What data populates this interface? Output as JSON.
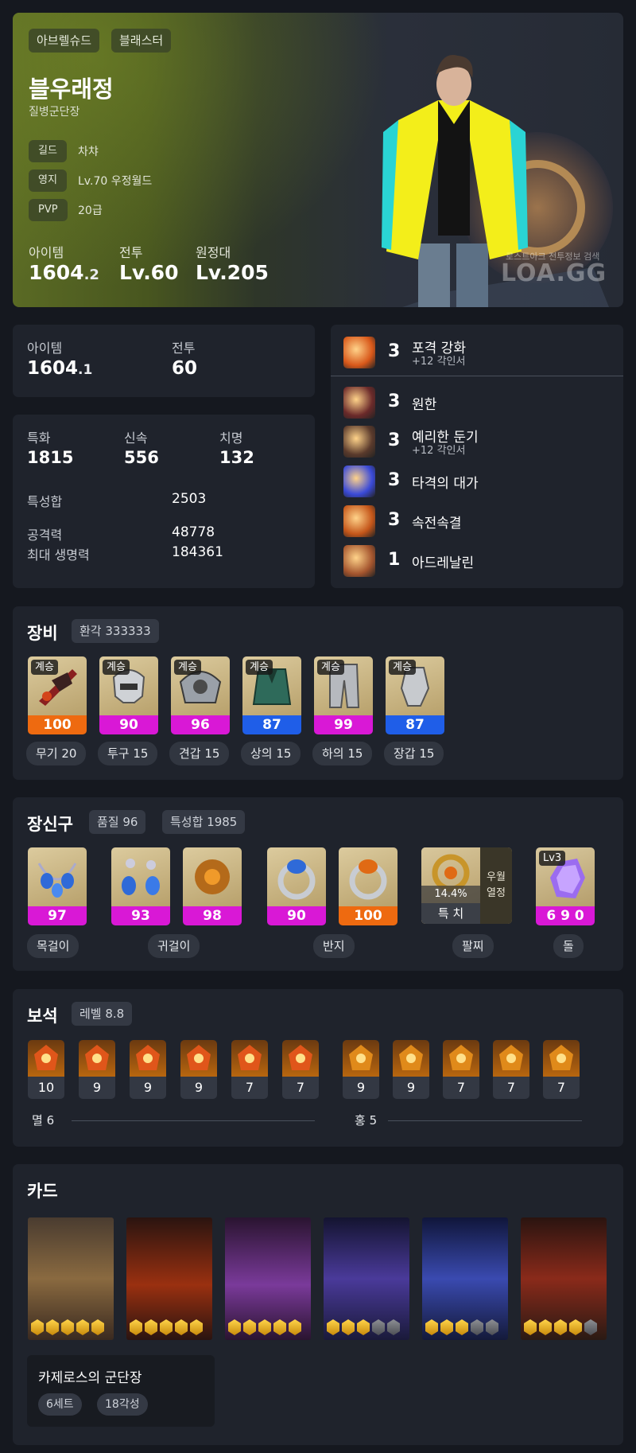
{
  "hero": {
    "server": "아브렐슈드",
    "class": "블래스터",
    "name": "블우래정",
    "title": "질병군단장",
    "info": [
      {
        "key": "길드",
        "value": "차챠"
      },
      {
        "key": "영지",
        "value": "Lv.70 우정월드"
      },
      {
        "key": "PVP",
        "value": "20급"
      }
    ],
    "stats": [
      {
        "label": "아이템",
        "main": "1604",
        "sub": ".2"
      },
      {
        "label": "전투",
        "main": "Lv.60",
        "sub": ""
      },
      {
        "label": "원정대",
        "main": "Lv.205",
        "sub": ""
      }
    ],
    "watermark_top": "로스트아크 전투정보 검색",
    "watermark": "LOA.GG"
  },
  "level_box": {
    "item_label": "아이템",
    "item_main": "1604",
    "item_sub": ".1",
    "combat_label": "전투",
    "combat_value": "60"
  },
  "stats_box": {
    "top": [
      {
        "label": "특화",
        "value": "1815"
      },
      {
        "label": "신속",
        "value": "556"
      },
      {
        "label": "치명",
        "value": "132"
      }
    ],
    "sum_label": "특성합",
    "sum_value": "2503",
    "atk_label": "공격력",
    "atk_value": "48778",
    "hp_label": "최대 생명력",
    "hp_value": "184361"
  },
  "engravings": [
    {
      "level": "3",
      "name": "포격 강화",
      "sub": "+12 각인서",
      "color": "#d8581a"
    },
    {
      "level": "3",
      "name": "원한",
      "sub": "",
      "color": "#6b2a2a"
    },
    {
      "level": "3",
      "name": "예리한 둔기",
      "sub": "+12 각인서",
      "color": "#5a3a2c"
    },
    {
      "level": "3",
      "name": "타격의 대가",
      "sub": "",
      "color": "#3a4ad8"
    },
    {
      "level": "3",
      "name": "속전속결",
      "sub": "",
      "color": "#c4561a"
    },
    {
      "level": "1",
      "name": "아드레날린",
      "sub": "",
      "color": "#a4552e"
    }
  ],
  "equipment": {
    "title": "장비",
    "badge": "환각 333333",
    "items": [
      {
        "tag": "계승",
        "quality": "100",
        "label": "무기 20",
        "color": "orange",
        "icon": "weapon-icon"
      },
      {
        "tag": "계승",
        "quality": "90",
        "label": "투구 15",
        "color": "magenta",
        "icon": "helmet-icon"
      },
      {
        "tag": "계승",
        "quality": "96",
        "label": "견갑 15",
        "color": "magenta",
        "icon": "shoulder-icon"
      },
      {
        "tag": "계승",
        "quality": "87",
        "label": "상의 15",
        "color": "blue",
        "icon": "chest-icon"
      },
      {
        "tag": "계승",
        "quality": "99",
        "label": "하의 15",
        "color": "magenta",
        "icon": "pants-icon"
      },
      {
        "tag": "계승",
        "quality": "87",
        "label": "장갑 15",
        "color": "blue",
        "icon": "gloves-icon"
      }
    ]
  },
  "accessories": {
    "title": "장신구",
    "badge1": "품질 96",
    "badge2": "특성합 1985",
    "items": [
      {
        "quality": "97",
        "color": "magenta",
        "icon": "necklace-icon"
      },
      {
        "quality": "93",
        "color": "magenta",
        "icon": "earring-icon"
      },
      {
        "quality": "98",
        "color": "magenta",
        "icon": "earring-icon"
      },
      {
        "quality": "90",
        "color": "magenta",
        "icon": "ring-icon"
      },
      {
        "quality": "100",
        "color": "orange",
        "icon": "ring-icon"
      }
    ],
    "labels": [
      "목걸이",
      "귀걸이",
      "반지",
      "팔찌",
      "돌"
    ],
    "bracelet_pct": "14.4%",
    "bracelet_stat": "특 치",
    "bracelet_side1": "우월",
    "bracelet_side2": "열정",
    "stone_lv": "Lv3",
    "stone_value": "6 9 0"
  },
  "gems": {
    "title": "보석",
    "badge": "레벨 8.8",
    "left": [
      "10",
      "9",
      "9",
      "9",
      "7",
      "7"
    ],
    "right": [
      "9",
      "9",
      "7",
      "7",
      "7"
    ],
    "left_label": "멸 6",
    "right_label": "홍 5"
  },
  "cards": {
    "title": "카드",
    "awakening": [
      5,
      5,
      5,
      3,
      3,
      4
    ],
    "set_name": "카제로스의 군단장",
    "set_count": "6세트",
    "set_awake": "18각성"
  }
}
